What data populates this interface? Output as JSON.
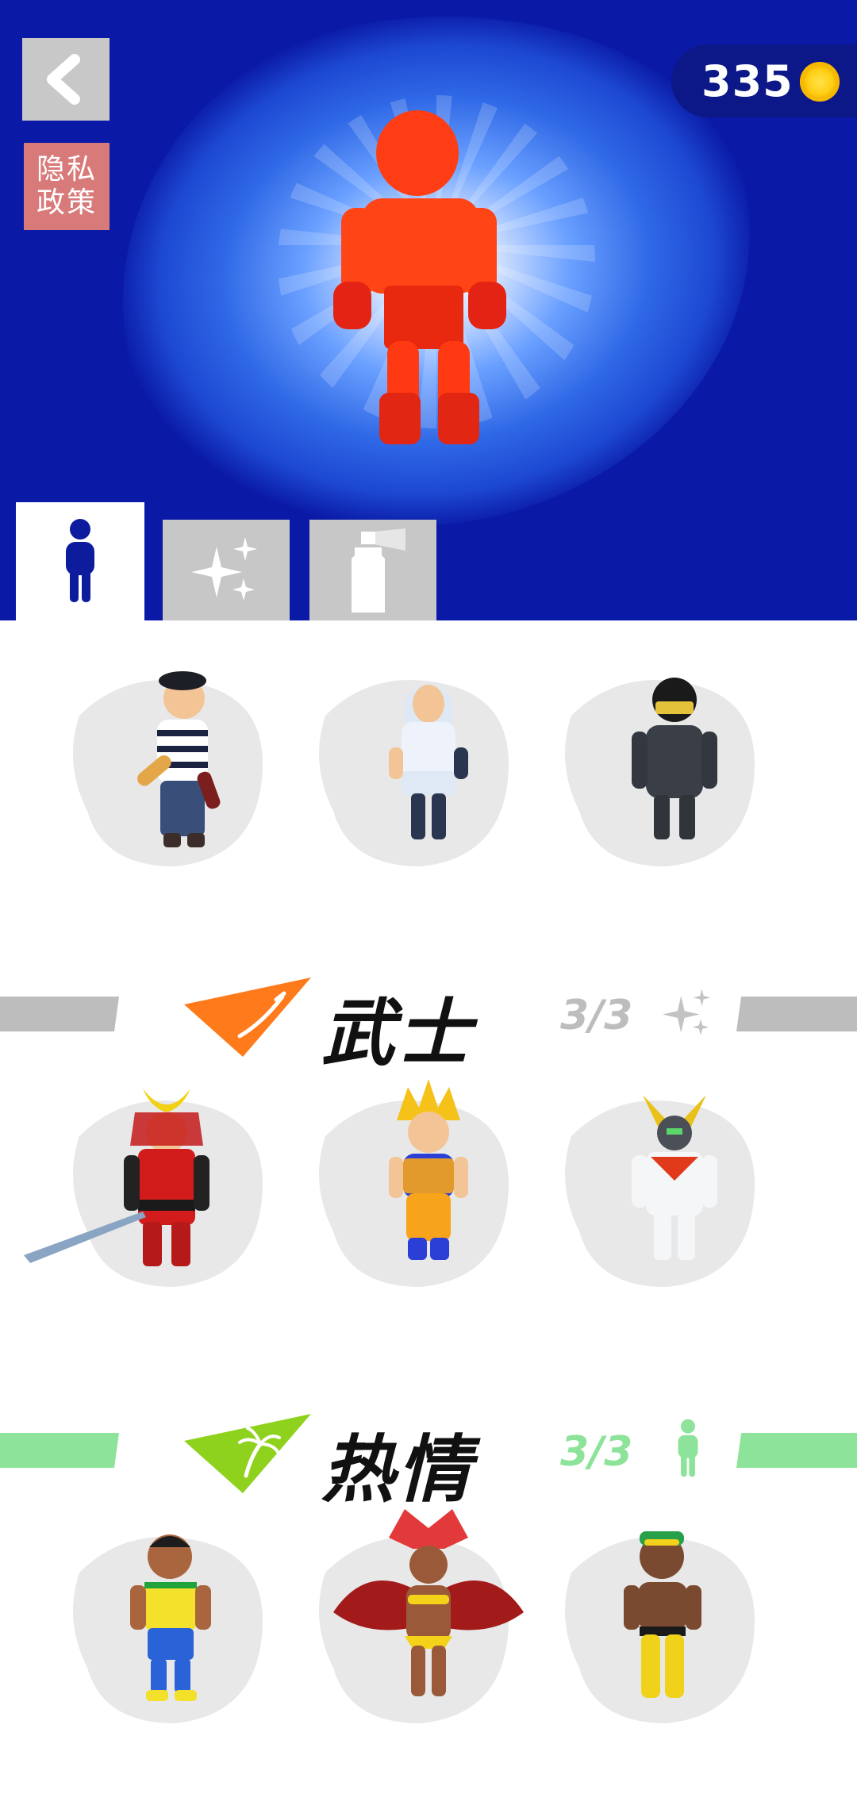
{
  "header": {
    "back_icon": "chevron-left-icon",
    "privacy_label": "隐私\n政策",
    "coins": "335",
    "coin_icon": "gold-coin-icon"
  },
  "tabs": [
    {
      "name": "characters",
      "icon": "person-icon",
      "active": true
    },
    {
      "name": "effects",
      "icon": "sparkles-icon",
      "active": false
    },
    {
      "name": "paint",
      "icon": "spray-can-icon",
      "active": false
    }
  ],
  "sections": [
    {
      "title": "",
      "characters": [
        "french-mime",
        "hooded-assassin",
        "helmet-robot"
      ]
    },
    {
      "title": "武士",
      "count": "3/3",
      "count_icon": "sparkles-icon",
      "badge_icon": "katana-icon",
      "color": "#bdbdbd",
      "characters": [
        "samurai",
        "super-fighter",
        "mecha-hero"
      ]
    },
    {
      "title": "热情",
      "count": "3/3",
      "count_icon": "person-icon",
      "badge_icon": "palm-tree-icon",
      "color": "#8de39a",
      "characters": [
        "soccer-player",
        "carnival-dancer",
        "capoeira-fighter"
      ]
    }
  ],
  "colors": {
    "header_bg": "#0a1aa6",
    "hero_red": "#ff3a12",
    "samurai_count": "#bdbdbd",
    "passion_count": "#8de39a"
  }
}
